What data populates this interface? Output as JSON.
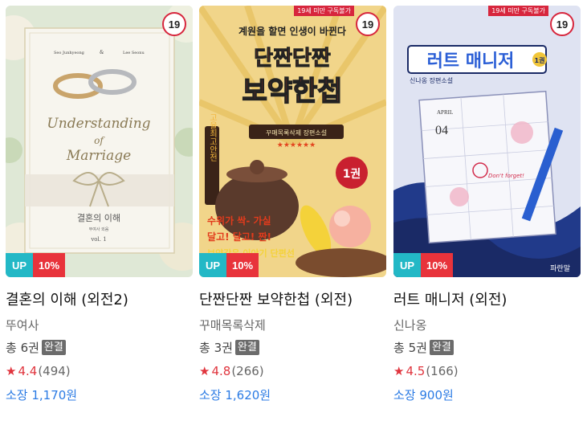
{
  "books": [
    {
      "title": "결혼의 이해 (외전2)",
      "author": "뚜여사",
      "count_label": "총 6권",
      "status": "완결",
      "rating": "4.4",
      "reviews": "(494)",
      "price": "소장 1,170원",
      "age": "19",
      "up_label": "UP",
      "discount": "10%",
      "cover": {
        "authors_line_left": "Seo Junhyeong",
        "authors_amp": "&",
        "authors_line_right": "Lee Seonu",
        "title_line1": "Understanding",
        "title_line2": "of",
        "title_line3": "Marriage",
        "ko_title": "결혼의 이해",
        "ko_author": "뚜여사 외음",
        "vol": "vol. 1"
      }
    },
    {
      "title": "단짠단짠 보약한첩 (외전)",
      "author": "꾸매목록삭제",
      "count_label": "총 3권",
      "status": "완결",
      "rating": "4.8",
      "reviews": "(266)",
      "price": "소장 1,620원",
      "age": "19",
      "age_banner": "19세 미만 구독불가",
      "up_label": "UP",
      "discount": "10%",
      "cover": {
        "top_line": "계원을 할면 인생이 바뀐다",
        "title1": "단짠단짠",
        "title2": "보약한첩",
        "sub": "꾸매목록삭제 장편소설",
        "side": "고율최고안전",
        "vol": "1권",
        "line1": "수위가 싹- 가실",
        "line2": "달고! 달고! 짠!",
        "line3": "보약같은 이야기 단편선"
      }
    },
    {
      "title": "러트 매니저 (외전)",
      "author": "신나옹",
      "count_label": "총 5권",
      "status": "완결",
      "rating": "4.5",
      "reviews": "(166)",
      "price": "소장 900원",
      "age": "19",
      "age_banner": "19세 미만 구독불가",
      "up_label": "UP",
      "discount": "10%",
      "cover": {
        "title": "러트 매니저",
        "vol": "1권",
        "sub": "신나옹 장편소설",
        "month": "APRIL",
        "day": "04",
        "note": "Don't forget!",
        "logo": "파란말"
      }
    }
  ],
  "colors": {
    "up_tag": "#23b8c6",
    "discount_tag": "#e8333b",
    "rating": "#e0343d",
    "price": "#2b7be4",
    "complete_badge": "#6b6b6b"
  }
}
